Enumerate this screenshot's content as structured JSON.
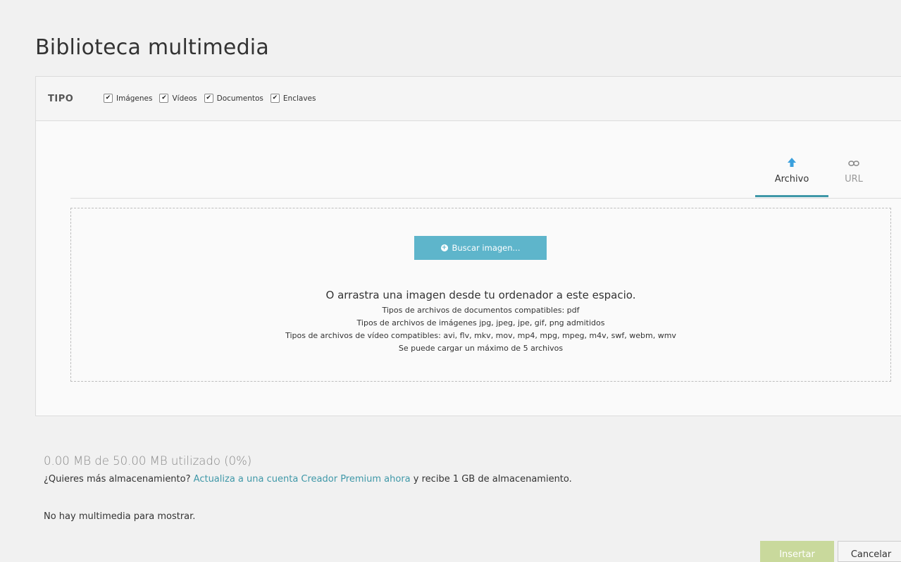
{
  "title": "Biblioteca multimedia",
  "filters": {
    "label": "TIPO",
    "items": [
      {
        "label": "Imágenes",
        "checked": true
      },
      {
        "label": "Vídeos",
        "checked": true
      },
      {
        "label": "Documentos",
        "checked": true
      },
      {
        "label": "Enclaves",
        "checked": true
      }
    ]
  },
  "tabs": [
    {
      "label": "Archivo",
      "icon": "upload-arrow-icon",
      "active": true
    },
    {
      "label": "URL",
      "icon": "link-icon",
      "active": false
    }
  ],
  "dropzone": {
    "button_label": "Buscar imagen...",
    "main_text": "O arrastra una imagen desde tu ordenador a este espacio.",
    "doc_types": "Tipos de archivos de documentos compatibles: pdf",
    "image_types": "Tipos de archivos de imágenes jpg, jpeg, jpe, gif, png admitidos",
    "video_types": "Tipos de archivos de vídeo compatibles: avi, flv, mkv, mov, mp4, mpg, mpeg, m4v, swf, webm, wmv",
    "max_files": "Se puede cargar un máximo de 5 archivos"
  },
  "storage": {
    "usage": "0.00 MB de 50.00 MB utilizado (0%)",
    "upsell_prefix": "¿Quieres más almacenamiento?",
    "upsell_link": "Actualiza a una cuenta Creador Premium ahora",
    "upsell_suffix": "y recibe 1 GB de almacenamiento."
  },
  "empty_message": "No hay multimedia para mostrar.",
  "footer": {
    "insert_label": "Insertar",
    "cancel_label": "Cancelar"
  },
  "colors": {
    "accent": "#5eb5cb",
    "tab_underline": "#3f98a8",
    "link": "#3f98a8",
    "insert_disabled": "#c9d99c"
  }
}
